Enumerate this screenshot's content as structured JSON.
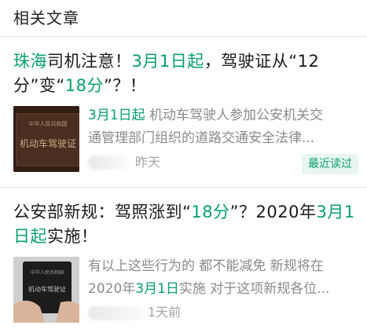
{
  "section": {
    "title": "相关文章"
  },
  "articles": [
    {
      "headline": [
        {
          "text": "珠海",
          "hl": true
        },
        {
          "text": "司机注意！",
          "hl": false
        },
        {
          "text": "3月1日起",
          "hl": true
        },
        {
          "text": "，驾驶证从“12分”变“",
          "hl": false
        },
        {
          "text": "18分",
          "hl": true
        },
        {
          "text": "”？！",
          "hl": false
        }
      ],
      "summary_lines": [
        [
          {
            "text": "3月1日起",
            "hl": true
          },
          {
            "text": " 机动车驾驶人参加公安机关交",
            "hl": false
          }
        ],
        [
          {
            "text": "通管理部门组织的道路交通安全法律...",
            "hl": false
          }
        ]
      ],
      "thumb_text": {
        "top": "中华人民共和国",
        "main": "机动车驾驶证"
      },
      "time": "昨天",
      "read_badge": "最近读过"
    },
    {
      "headline": [
        {
          "text": "公安部新规：驾照涨到“",
          "hl": false
        },
        {
          "text": "18分",
          "hl": true
        },
        {
          "text": "”？2020年",
          "hl": false
        },
        {
          "text": "3月1日起",
          "hl": true
        },
        {
          "text": "实施！",
          "hl": false
        }
      ],
      "summary_lines": [
        [
          {
            "text": "有以上这些行为的 都不能减免 新规将在",
            "hl": false
          }
        ],
        [
          {
            "text": "2020年",
            "hl": false
          },
          {
            "text": "3月1日",
            "hl": true
          },
          {
            "text": "实施 对于这项新规各位...",
            "hl": false
          }
        ]
      ],
      "thumb_text": {
        "top": "中华人民共和国",
        "main": "机动车驾驶证"
      },
      "time": "1天前"
    }
  ],
  "colors": {
    "accent": "#07a06a",
    "meta": "#a3a3a3",
    "summary": "#8a8a8a"
  }
}
